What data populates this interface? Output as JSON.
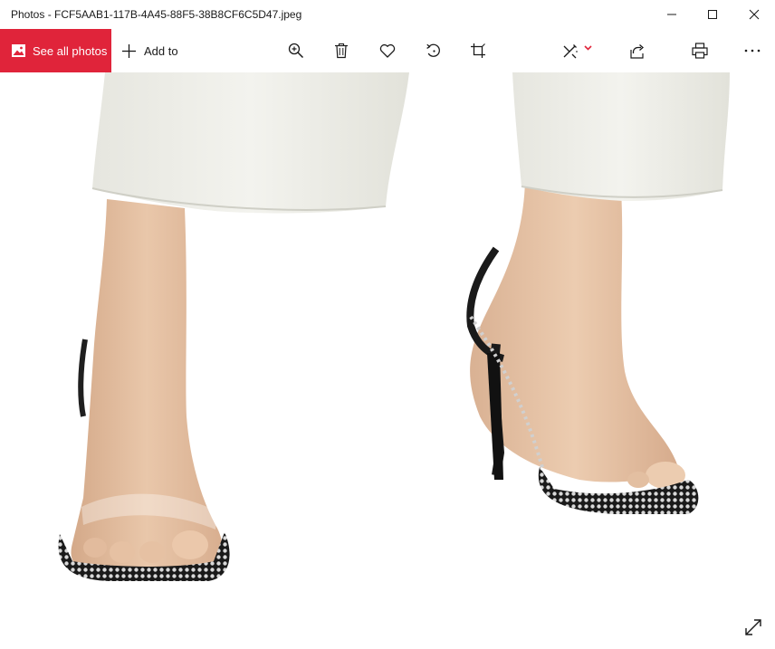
{
  "window": {
    "title": "Photos - FCF5AAB1-117B-4A45-88F5-38B8CF6C5D47.jpeg"
  },
  "toolbar": {
    "see_all_label": "See all photos",
    "add_to_label": "Add to",
    "accent_color": "#e0243a",
    "edit_chevron_color": "#e0243a"
  },
  "icons": {
    "window": [
      "minimize-icon",
      "maximize-icon",
      "close-icon"
    ],
    "toolbar": [
      "photos-icon",
      "plus-icon",
      "zoom-in-icon",
      "delete-icon",
      "favorite-icon",
      "rotate-icon",
      "crop-icon",
      "edit-icon",
      "chevron-down-icon",
      "share-icon",
      "print-icon",
      "more-icon"
    ],
    "viewer": [
      "expand-icon"
    ]
  }
}
